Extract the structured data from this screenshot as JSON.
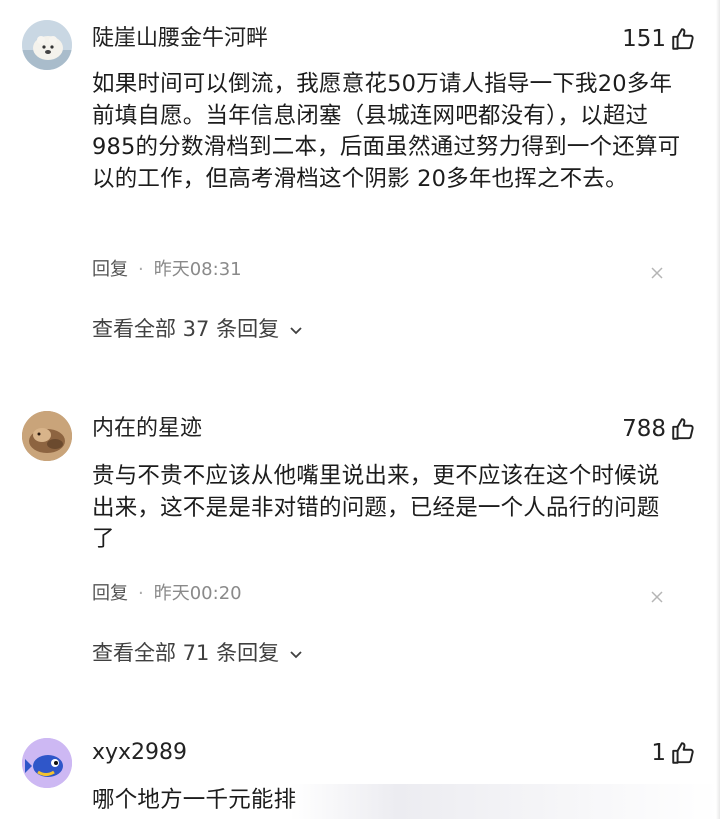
{
  "comments": [
    {
      "username": "陡崖山腰金牛河畔",
      "likes": "151",
      "text": "如果时间可以倒流，我愿意花50万请人指导一下我20多年前填自愿。当年信息闭塞（县城连网吧都没有），以超过985的分数滑档到二本，后面虽然通过努力得到一个还算可以的工作，但高考滑档这个阴影 20多年也挥之不去。",
      "reply_label": "回复",
      "separator": "·",
      "time": "昨天08:31",
      "view_replies": "查看全部 37 条回复",
      "avatar_icon": "polar-bear-avatar-icon"
    },
    {
      "username": "内在的星迹",
      "likes": "788",
      "text": "贵与不贵不应该从他嘴里说出来，更不应该在这个时候说出来，这不是是非对错的问题，已经是一个人品行的问题了",
      "reply_label": "回复",
      "separator": "·",
      "time": "昨天00:20",
      "view_replies": "查看全部 71 条回复",
      "avatar_icon": "animal-photo-avatar-icon"
    },
    {
      "username": "xyx2989",
      "likes": "1",
      "text": "哪个地方一千元能排",
      "avatar_icon": "blue-fish-cartoon-avatar-icon"
    }
  ],
  "colors": {
    "text": "#222222",
    "meta": "#8a8a8a",
    "background": "#ffffff"
  },
  "icons": {
    "like": "thumbs-up-icon",
    "close": "close-icon",
    "chevron": "chevron-down-icon"
  }
}
